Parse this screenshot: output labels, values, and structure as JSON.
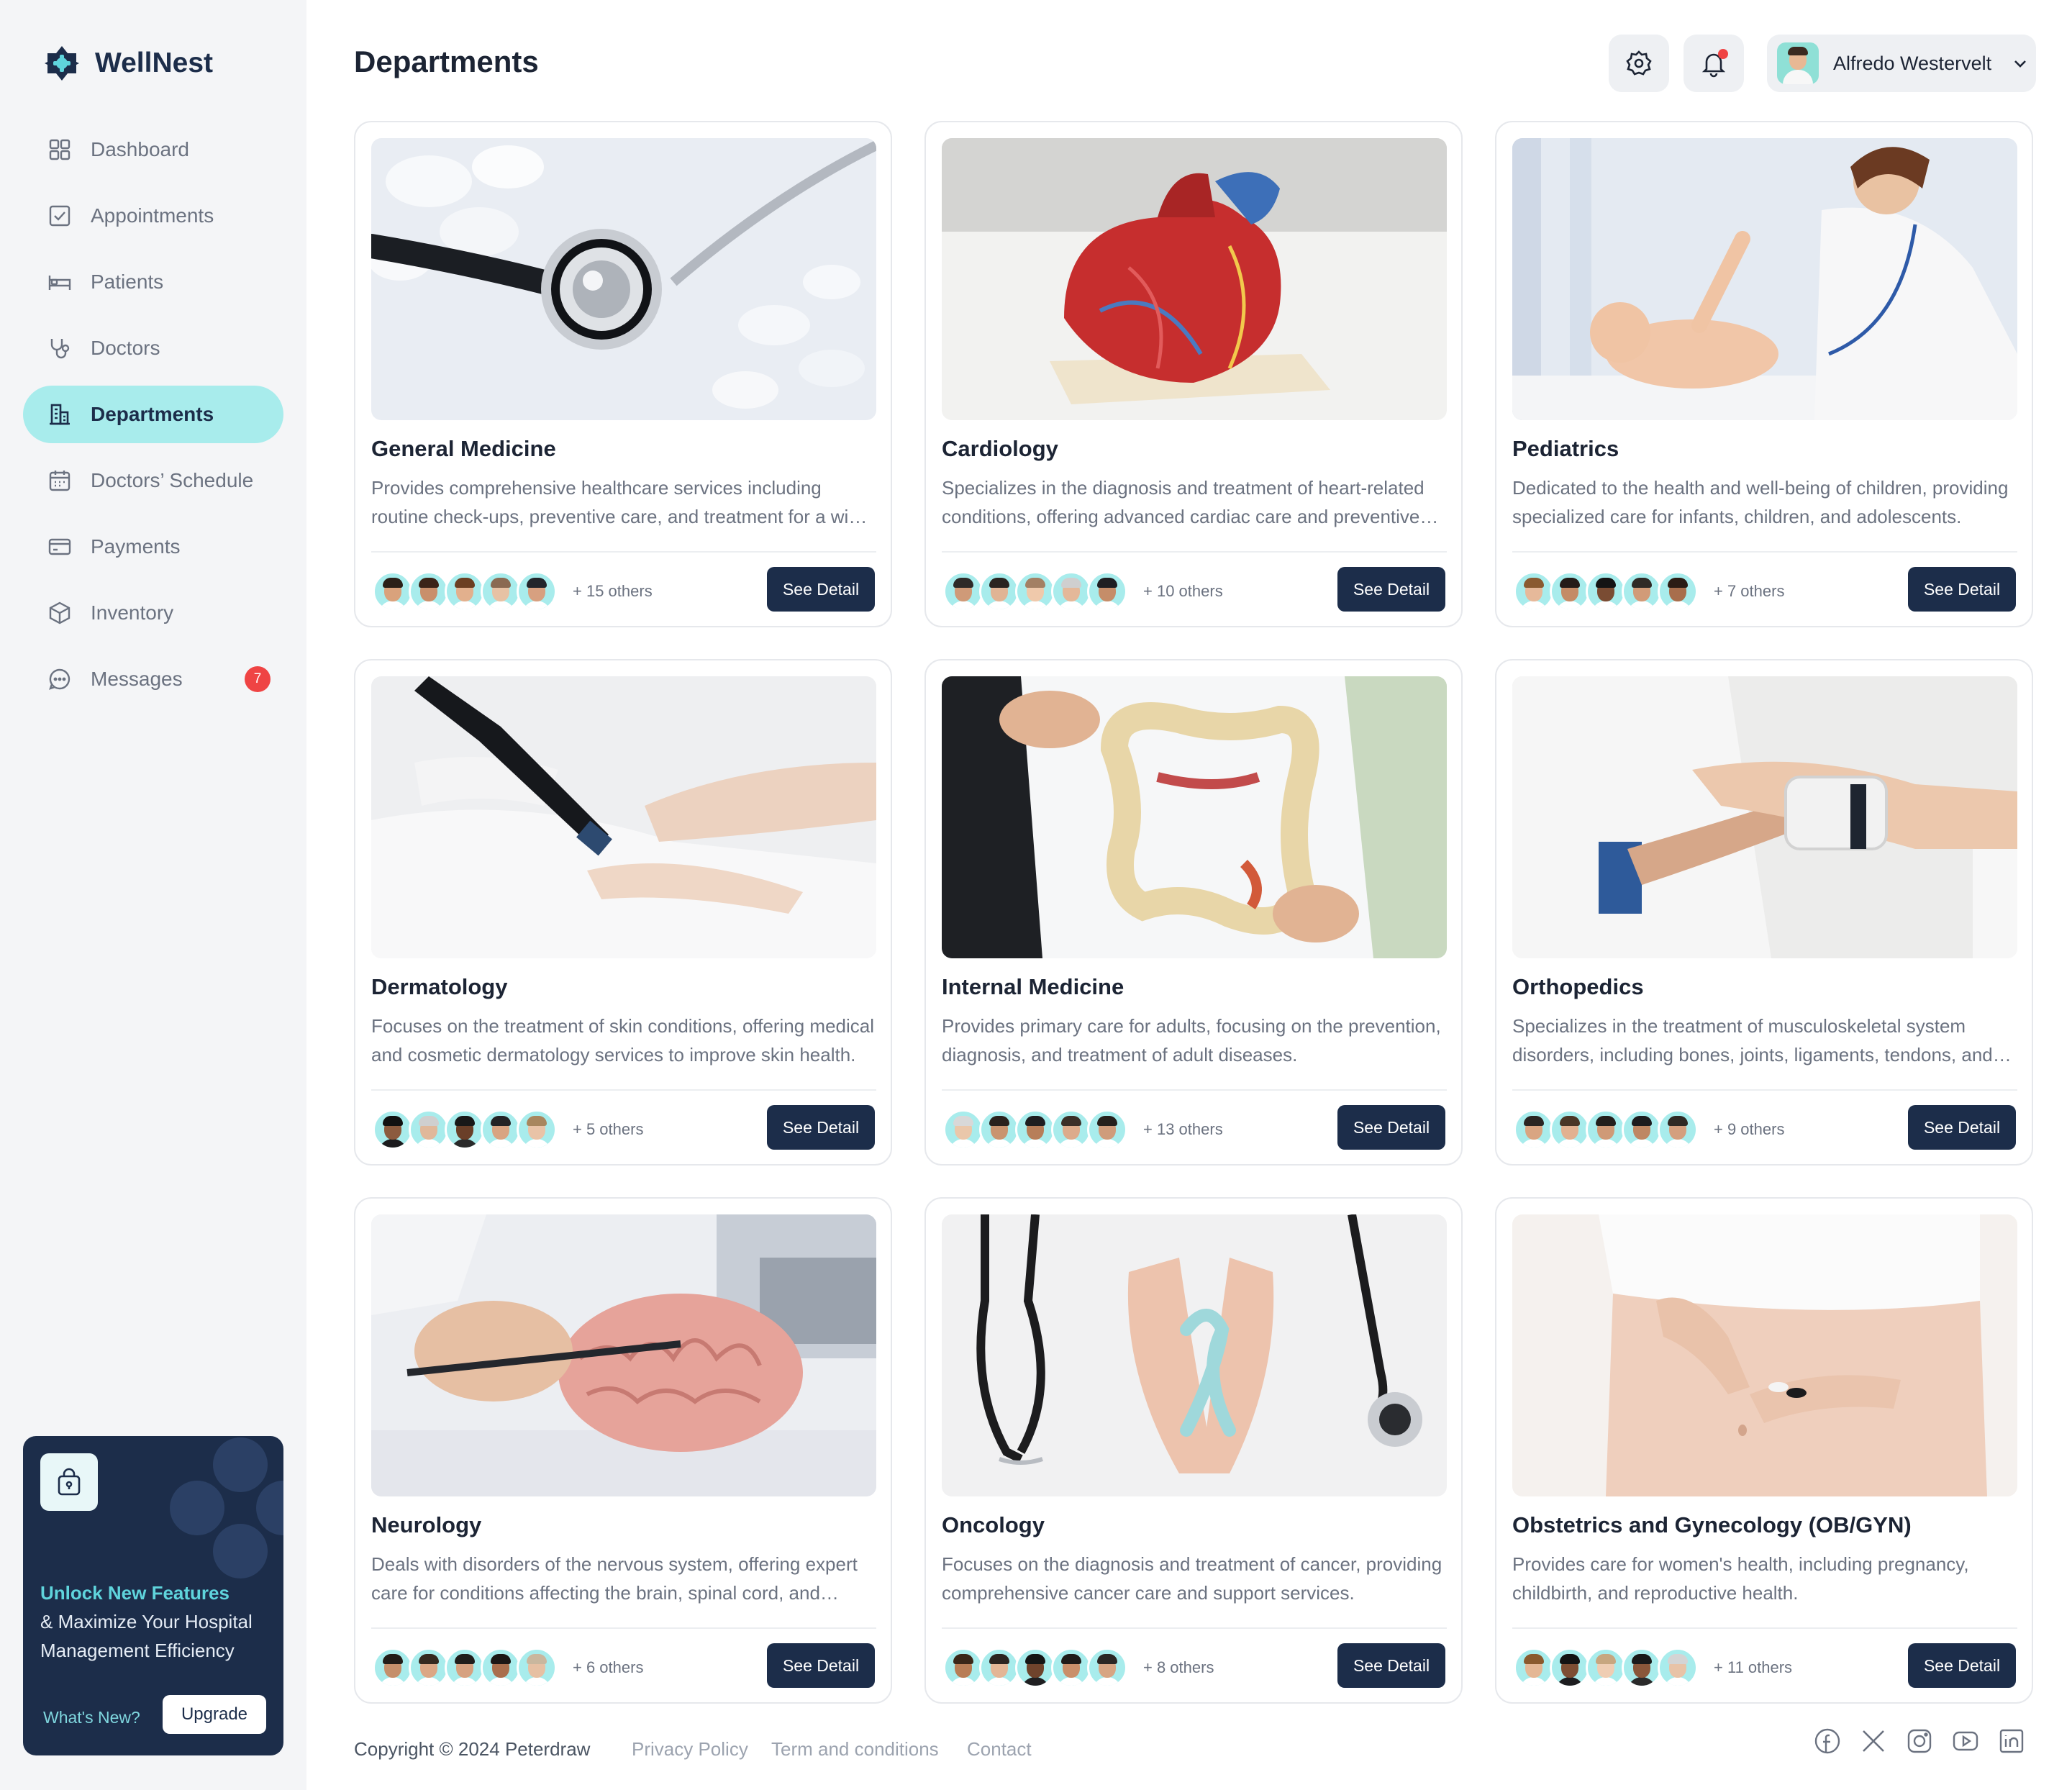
{
  "brand": {
    "name": "WellNest"
  },
  "colors": {
    "primary": "#1c2d4a",
    "accent": "#a8ecec",
    "badge": "#ef4444"
  },
  "sidebar": {
    "items": [
      {
        "label": "Dashboard",
        "icon": "grid-icon"
      },
      {
        "label": "Appointments",
        "icon": "checkbox-icon"
      },
      {
        "label": "Patients",
        "icon": "bed-icon"
      },
      {
        "label": "Doctors",
        "icon": "stethoscope-icon"
      },
      {
        "label": "Departments",
        "icon": "building-icon",
        "active": true
      },
      {
        "label": "Doctors’ Schedule",
        "icon": "calendar-icon"
      },
      {
        "label": "Payments",
        "icon": "card-icon"
      },
      {
        "label": "Inventory",
        "icon": "box-icon"
      },
      {
        "label": "Messages",
        "icon": "chat-icon",
        "badge": "7"
      }
    ]
  },
  "promo": {
    "highlight": "Unlock New Features",
    "text": "& Maximize Your Hospital Management Efficiency",
    "link": "What's New?",
    "button": "Upgrade"
  },
  "header": {
    "title": "Departments",
    "user_name": "Alfredo Westervelt"
  },
  "departments": [
    {
      "name": "General Medicine",
      "description": "Provides comprehensive healthcare services including routine check-ups, preventive care, and treatment for a wide range of illnesses.",
      "others": "+ 15 others",
      "button": "See Detail"
    },
    {
      "name": "Cardiology",
      "description": "Specializes in the diagnosis and treatment of heart-related conditions, offering advanced cardiac care and preventive treatments.",
      "others": "+ 10 others",
      "button": "See Detail"
    },
    {
      "name": "Pediatrics",
      "description": "Dedicated to the health and well-being of children, providing specialized care for infants, children, and adolescents.",
      "others": "+ 7 others",
      "button": "See Detail"
    },
    {
      "name": "Dermatology",
      "description": "Focuses on the treatment of skin conditions, offering medical and cosmetic dermatology services to improve skin health.",
      "others": "+ 5 others",
      "button": "See Detail"
    },
    {
      "name": "Internal Medicine",
      "description": "Provides primary care for adults, focusing on the prevention, diagnosis, and treatment of adult diseases.",
      "others": "+ 13 others",
      "button": "See Detail"
    },
    {
      "name": "Orthopedics",
      "description": "Specializes in the treatment of musculoskeletal system disorders, including bones, joints, ligaments, tendons, and muscles.",
      "others": "+ 9 others",
      "button": "See Detail"
    },
    {
      "name": "Neurology",
      "description": "Deals with disorders of the nervous system, offering expert care for conditions affecting the brain, spinal cord, and nerves.",
      "others": "+ 6 others",
      "button": "See Detail"
    },
    {
      "name": "Oncology",
      "description": "Focuses on the diagnosis and treatment of cancer, providing comprehensive cancer care and support services.",
      "others": "+ 8 others",
      "button": "See Detail"
    },
    {
      "name": "Obstetrics and Gynecology (OB/GYN)",
      "description": "Provides care for women's health, including pregnancy, childbirth, and reproductive health.",
      "others": "+ 11 others",
      "button": "See Detail"
    }
  ],
  "footer": {
    "copyright": "Copyright © 2024 Peterdraw",
    "links": [
      "Privacy Policy",
      "Term and conditions",
      "Contact"
    ],
    "social": [
      "facebook-icon",
      "x-icon",
      "instagram-icon",
      "youtube-icon",
      "linkedin-icon"
    ]
  }
}
